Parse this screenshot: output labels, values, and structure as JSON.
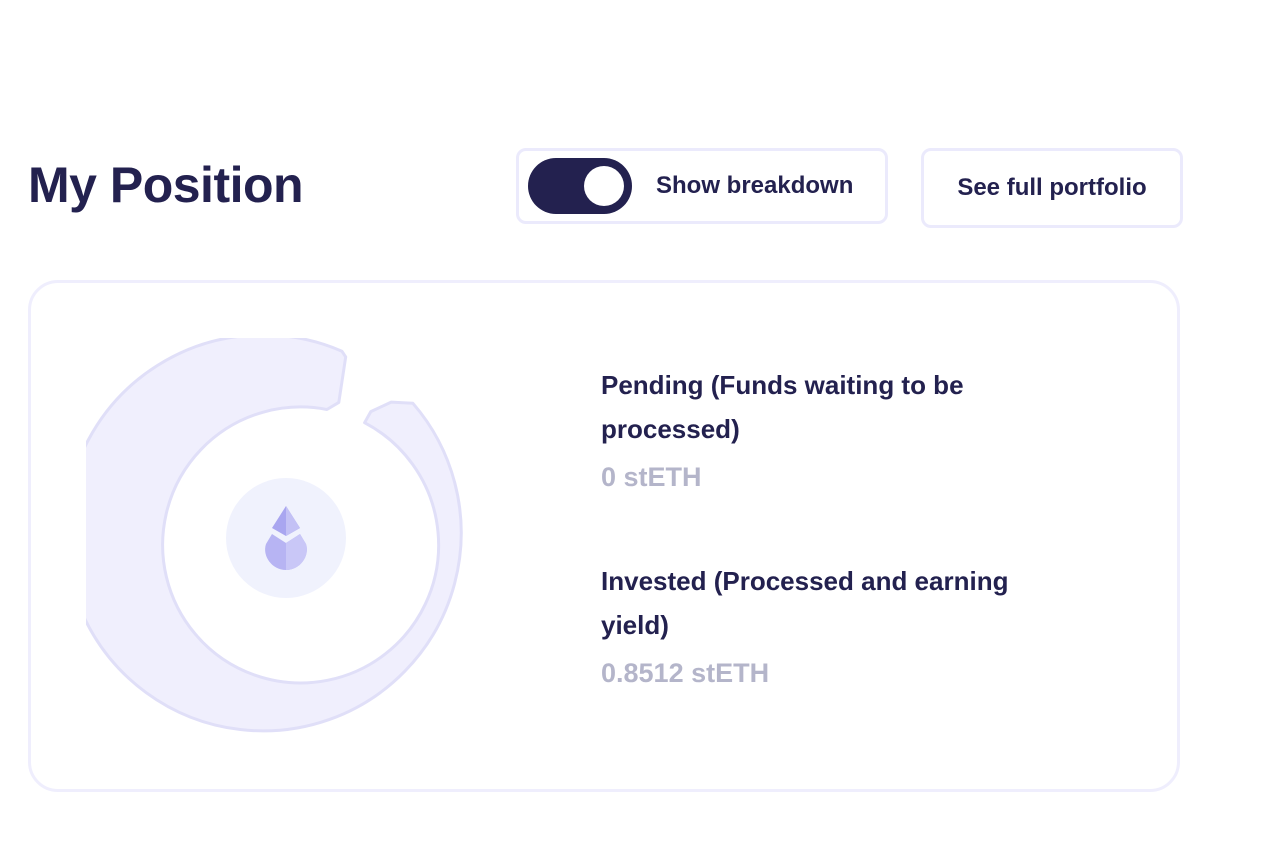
{
  "header": {
    "title": "My Position",
    "breakdown_toggle": {
      "label": "Show breakdown",
      "checked": true
    },
    "portfolio_button_label": "See full portfolio"
  },
  "position": {
    "items": [
      {
        "label": "Pending (Funds waiting to be processed)",
        "value": "0 stETH"
      },
      {
        "label": "Invested (Processed and earning yield)",
        "value": "0.8512 stETH"
      }
    ],
    "center_icon": "steth-drop-icon"
  },
  "colors": {
    "primary": "#23214f",
    "muted_value": "#b4b5ca",
    "border": "#ebeafc",
    "donut_fill": "#f0effd",
    "donut_stroke": "#e0dff8",
    "icon_bg": "#f0f2fd",
    "icon_fill": "#a9a6f0"
  }
}
